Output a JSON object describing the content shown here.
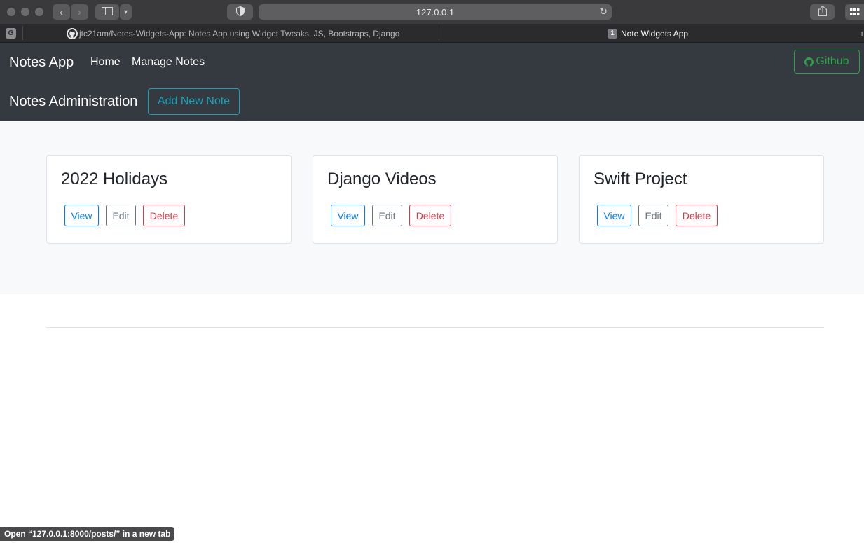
{
  "browser": {
    "url": "127.0.0.1",
    "pinned_tab_letter": "G",
    "tabs": [
      {
        "title": "jtc21am/Notes-Widgets-App: Notes App using Widget Tweaks, JS, Bootstraps, Django",
        "active": false
      },
      {
        "title": "Note Widgets App",
        "badge": "1",
        "active": true
      }
    ],
    "status_tooltip": "Open “127.0.0.1:8000/posts/” in a new tab"
  },
  "navbar": {
    "brand": "Notes App",
    "links": [
      "Home",
      "Manage Notes"
    ],
    "github_label": "Github"
  },
  "admin": {
    "title": "Notes Administration",
    "add_button": "Add New Note"
  },
  "notes": [
    {
      "title": "2022 Holidays",
      "view": "View",
      "edit": "Edit",
      "delete": "Delete"
    },
    {
      "title": "Django Videos",
      "view": "View",
      "edit": "Edit",
      "delete": "Delete"
    },
    {
      "title": "Swift Project",
      "view": "View",
      "edit": "Edit",
      "delete": "Delete"
    }
  ],
  "colors": {
    "navbar_bg": "#343a40",
    "github": "#28a745",
    "add": "#17a2b8",
    "view": "#007bff",
    "edit": "#6c757d",
    "delete": "#dc3545"
  }
}
